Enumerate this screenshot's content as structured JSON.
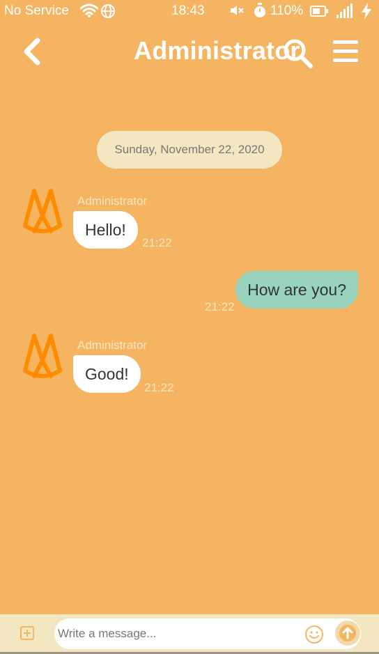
{
  "status_bar": {
    "carrier": "No Service",
    "time": "18:43",
    "battery_percent": "110%",
    "icons": [
      "wifi-icon",
      "globe-icon",
      "mute-icon",
      "timer-icon",
      "battery-icon",
      "signal-icon",
      "charging-bolt-icon"
    ]
  },
  "header": {
    "title": "Administrator",
    "icons": [
      "back-chevron-icon",
      "search-icon",
      "hamburger-menu-icon"
    ]
  },
  "chat": {
    "date_separator": "Sunday, November 22, 2020",
    "messages": [
      {
        "direction": "incoming",
        "sender": "Administrator",
        "text": "Hello!",
        "time": "21:22"
      },
      {
        "direction": "outgoing",
        "text": "How are you?",
        "time": "21:22"
      },
      {
        "direction": "incoming",
        "sender": "Administrator",
        "text": "Good!",
        "time": "21:22"
      }
    ]
  },
  "composer": {
    "placeholder": "Write a message...",
    "value": "",
    "icons": [
      "attach-plus-icon",
      "emoji-icon",
      "send-arrow-icon"
    ]
  },
  "colors": {
    "background": "#f5b462",
    "date_pill": "#f2e7c0",
    "bubble_incoming": "#ffffff",
    "bubble_outgoing": "#99d3bd",
    "avatar_accent": "#ff8c00",
    "composer_bar": "#f2e7c0"
  }
}
